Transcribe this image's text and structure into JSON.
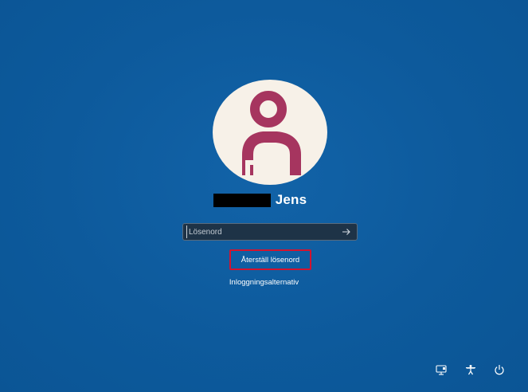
{
  "login": {
    "user_name": "Jens",
    "password_placeholder": "Lösenord",
    "reset_password_label": "Återställ lösenord",
    "signin_options_label": "Inloggningsalternativ"
  },
  "avatar": {
    "colors": {
      "background": "#f7f1e8",
      "figure": "#a6355f"
    }
  },
  "system_icons": [
    {
      "name": "network-icon"
    },
    {
      "name": "accessibility-icon"
    },
    {
      "name": "power-icon"
    }
  ],
  "colors": {
    "background": "#0d5a9c",
    "highlight_border": "#d3132f",
    "text": "#ffffff"
  }
}
